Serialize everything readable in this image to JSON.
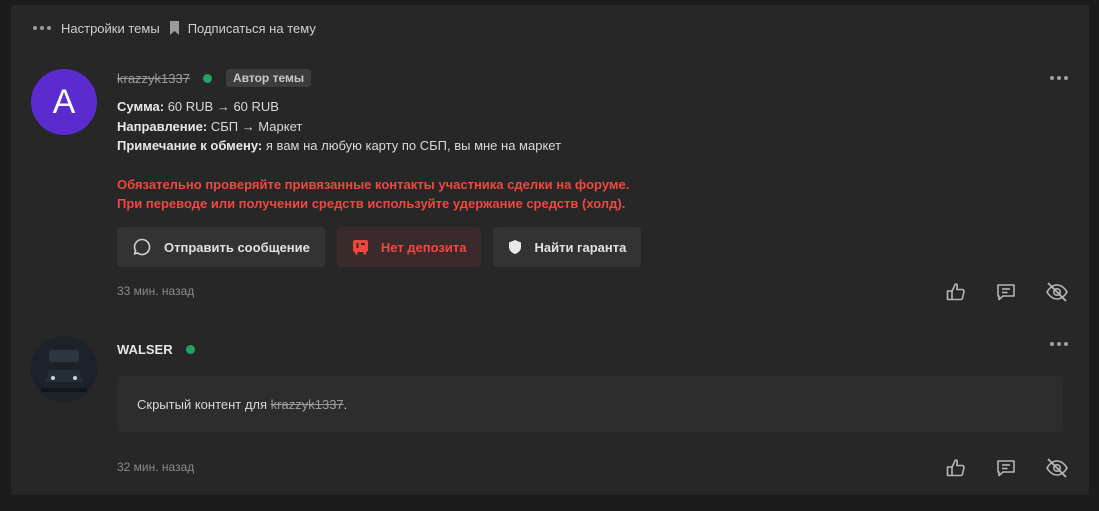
{
  "topbar": {
    "settings_label": "Настройки темы",
    "subscribe_label": "Подписаться на тему"
  },
  "post1": {
    "avatar_letter": "A",
    "avatar_color": "#5b2bd0",
    "username": "krazzyk1337",
    "badge": "Автор темы",
    "lines": [
      {
        "label": "Сумма:",
        "value": "60 RUB → 60 RUB"
      },
      {
        "label": "Направление:",
        "value": "СБП → Маркет"
      },
      {
        "label": "Примечание к обмену:",
        "value": "я вам на любую карту по СБП, вы мне на маркет"
      }
    ],
    "warning_line1": "Обязательно проверяйте привязанные контакты участника сделки на форуме.",
    "warning_line2": "При переводе или получении средств используйте удержание средств (холд).",
    "buttons": {
      "message": "Отправить сообщение",
      "no_deposit": "Нет депозита",
      "guarantor": "Найти гаранта"
    },
    "time": "33 мин. назад"
  },
  "post2": {
    "username": "WALSER",
    "hidden_prefix": "Скрытый контент для ",
    "hidden_user": "krazzyk1337",
    "hidden_suffix": ".",
    "time": "32 мин. назад"
  },
  "colors": {
    "online": "#1fa466",
    "warning": "#f0473f",
    "panel": "#272727"
  },
  "icons": [
    "more-dots-icon",
    "bookmark-icon",
    "chat-bubble-icon",
    "deposit-icon",
    "shield-icon",
    "like-icon",
    "reply-icon",
    "hide-eye-icon"
  ]
}
